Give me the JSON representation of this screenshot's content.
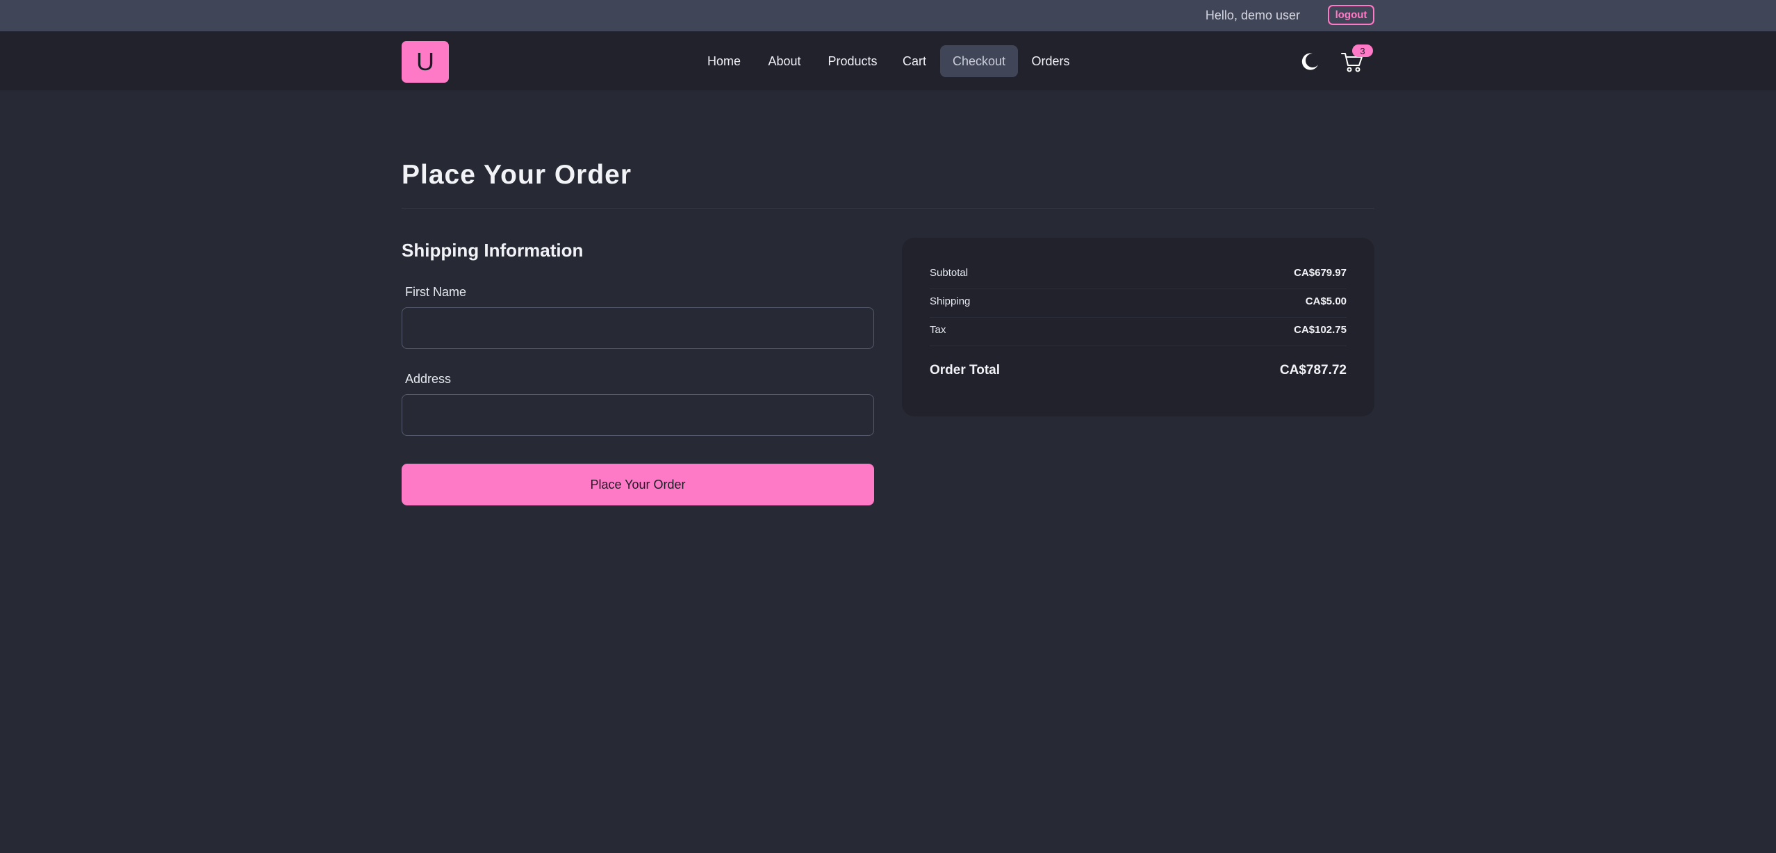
{
  "userbar": {
    "greeting": "Hello, demo user",
    "logout_label": "logout"
  },
  "navbar": {
    "logo_letter": "U",
    "links": [
      {
        "label": "Home"
      },
      {
        "label": "About"
      },
      {
        "label": "Products"
      },
      {
        "label": "Cart"
      },
      {
        "label": "Checkout",
        "active": true
      },
      {
        "label": "Orders"
      }
    ],
    "theme_icon": "moon-icon",
    "cart_icon": "cart-icon",
    "cart_count": "3"
  },
  "main": {
    "page_title": "Place Your Order",
    "shipping": {
      "section_title": "Shipping Information",
      "first_name_label": "First Name",
      "first_name_value": "",
      "address_label": "Address",
      "address_value": ""
    },
    "submit_label": "Place Your Order"
  },
  "summary": {
    "rows": [
      {
        "label": "Subtotal",
        "value": "CA$679.97"
      },
      {
        "label": "Shipping",
        "value": "CA$5.00"
      },
      {
        "label": "Tax",
        "value": "CA$102.75"
      }
    ],
    "total_label": "Order Total",
    "total_value": "CA$787.72"
  },
  "colors": {
    "accent": "#ff7ac6",
    "background": "#272935",
    "navbar": "#21222c",
    "userbar": "#414558"
  }
}
